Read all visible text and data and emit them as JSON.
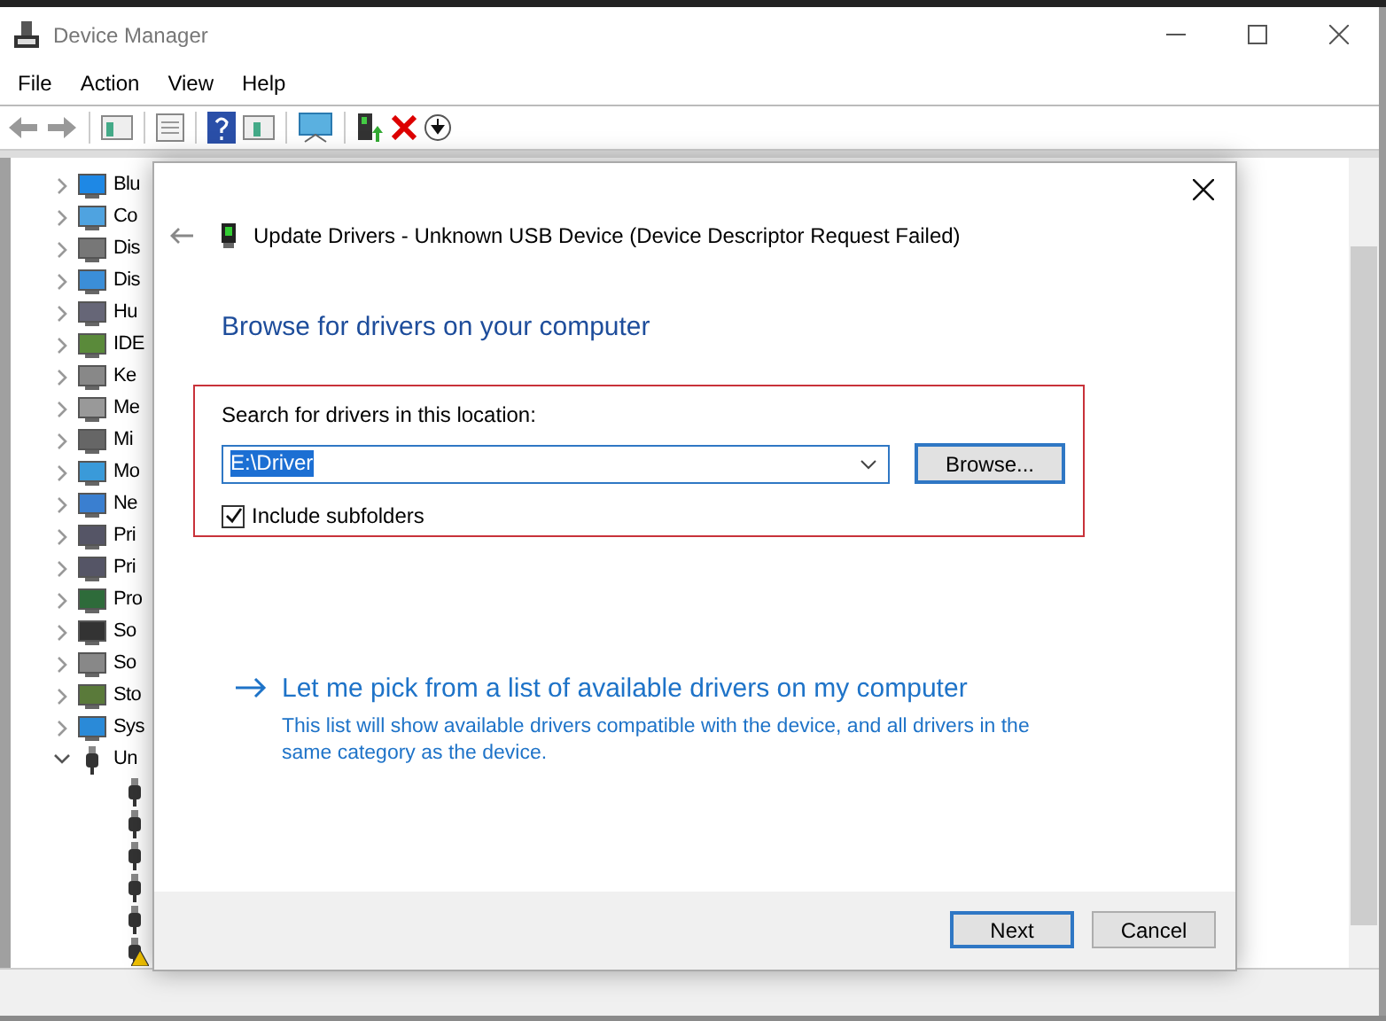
{
  "window": {
    "title": "Device Manager"
  },
  "menu": [
    "File",
    "Action",
    "View",
    "Help"
  ],
  "tree": [
    {
      "label": "Blu",
      "expanded": false
    },
    {
      "label": "Co",
      "expanded": false
    },
    {
      "label": "Dis",
      "expanded": false
    },
    {
      "label": "Dis",
      "expanded": false
    },
    {
      "label": "Hu",
      "expanded": false
    },
    {
      "label": "IDE",
      "expanded": false
    },
    {
      "label": "Ke",
      "expanded": false
    },
    {
      "label": "Me",
      "expanded": false
    },
    {
      "label": "Mi",
      "expanded": false
    },
    {
      "label": "Mo",
      "expanded": false
    },
    {
      "label": "Ne",
      "expanded": false
    },
    {
      "label": "Pri",
      "expanded": false
    },
    {
      "label": "Pri",
      "expanded": false
    },
    {
      "label": "Pro",
      "expanded": false
    },
    {
      "label": "So",
      "expanded": false
    },
    {
      "label": "So",
      "expanded": false
    },
    {
      "label": "Sto",
      "expanded": false
    },
    {
      "label": "Sys",
      "expanded": false
    },
    {
      "label": "Un",
      "expanded": true,
      "children": [
        {
          "warning": false
        },
        {
          "warning": false
        },
        {
          "warning": false
        },
        {
          "warning": false
        },
        {
          "warning": false
        },
        {
          "warning": true
        }
      ]
    }
  ],
  "dialog": {
    "title": "Update Drivers - Unknown USB Device (Device Descriptor Request Failed)",
    "heading": "Browse for drivers on your computer",
    "location_label": "Search for drivers in this location:",
    "location_value": "E:\\Driver",
    "browse_button": "Browse...",
    "include_subfolders": {
      "label": "Include subfolders",
      "checked": true
    },
    "pick_link": "Let me pick from a list of available drivers on my computer",
    "pick_description": "This list will show available drivers compatible with the device, and all drivers in the same category as the device.",
    "buttons": [
      {
        "label": "Next",
        "default": true
      },
      {
        "label": "Cancel",
        "default": false
      }
    ]
  }
}
